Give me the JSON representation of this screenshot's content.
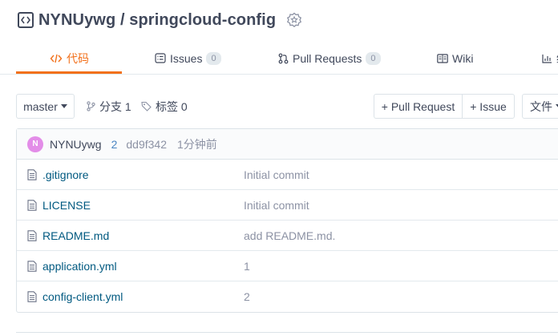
{
  "repo": {
    "owner": "NYNUywg",
    "separator": " / ",
    "name": "springcloud-config"
  },
  "tabs": [
    {
      "label": "代码",
      "icon": "code-icon",
      "active": true
    },
    {
      "label": "Issues",
      "count": "0",
      "icon": "issues-icon"
    },
    {
      "label": "Pull Requests",
      "count": "0",
      "icon": "pull-request-icon"
    },
    {
      "label": "Wiki",
      "icon": "wiki-icon"
    },
    {
      "label": "统",
      "icon": "stats-icon"
    }
  ],
  "toolbar": {
    "branch": "master",
    "branches_label": "分支 1",
    "tags_label": "标签 0",
    "pull_request_button": "+ Pull Request",
    "issue_button": "+ Issue",
    "file_menu": "文件"
  },
  "commit": {
    "avatar_letter": "N",
    "author": "NYNUywg",
    "count": "2",
    "sha": "dd9f342",
    "time": "1分钟前"
  },
  "files": [
    {
      "name": ".gitignore",
      "message": "Initial commit"
    },
    {
      "name": "LICENSE",
      "message": "Initial commit"
    },
    {
      "name": "README.md",
      "message": "add README.md."
    },
    {
      "name": "application.yml",
      "message": "1"
    },
    {
      "name": "config-client.yml",
      "message": "2"
    }
  ],
  "colors": {
    "accent": "#f2711c",
    "link": "#005980",
    "avatar": "#e38de8"
  }
}
